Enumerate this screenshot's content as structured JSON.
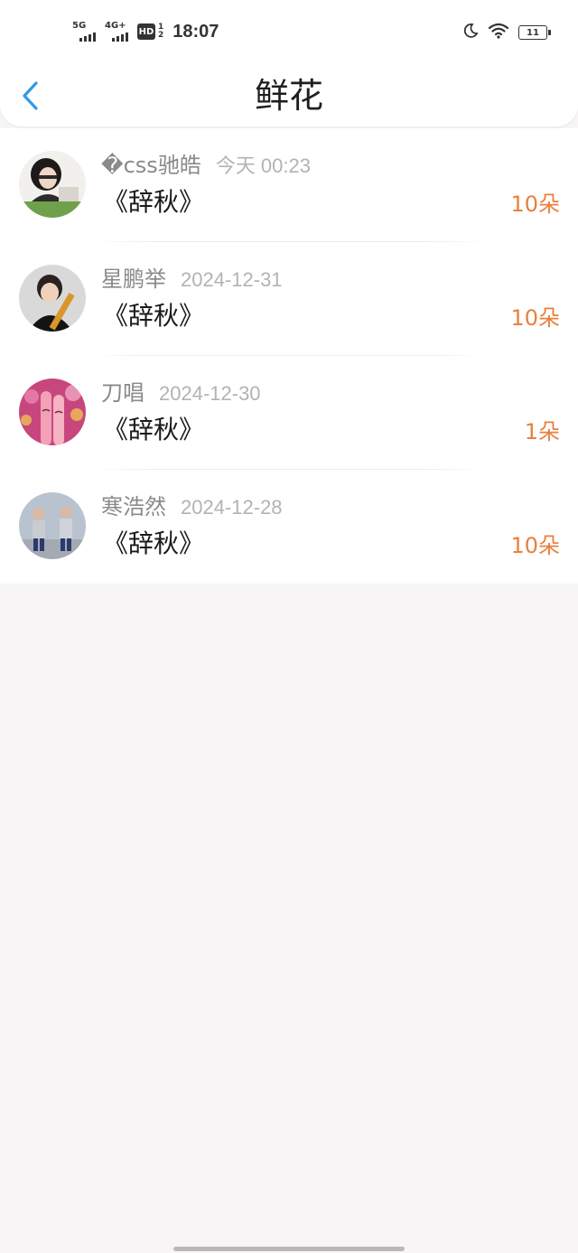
{
  "status_bar": {
    "net1": "5G",
    "net2": "4G+",
    "hd": "HD",
    "hd_sub_top": "1",
    "hd_sub_bottom": "2",
    "time": "18:07",
    "battery": "11"
  },
  "header": {
    "title": "鲜花"
  },
  "colors": {
    "accent": "#2f9be6",
    "count": "#e8803c",
    "name": "#8a8a8a",
    "date": "#b3b3b3"
  },
  "rows": [
    {
      "name": "�css驰皓",
      "date": "今天 00:23",
      "gift": "《辞秋》",
      "count": "10朵"
    },
    {
      "name": "星鹏举",
      "date": "2024-12-31",
      "gift": "《辞秋》",
      "count": "10朵"
    },
    {
      "name": "刀唱",
      "date": "2024-12-30",
      "gift": "《辞秋》",
      "count": "1朵"
    },
    {
      "name": "寒浩然",
      "date": "2024-12-28",
      "gift": "《辞秋》",
      "count": "10朵"
    }
  ]
}
